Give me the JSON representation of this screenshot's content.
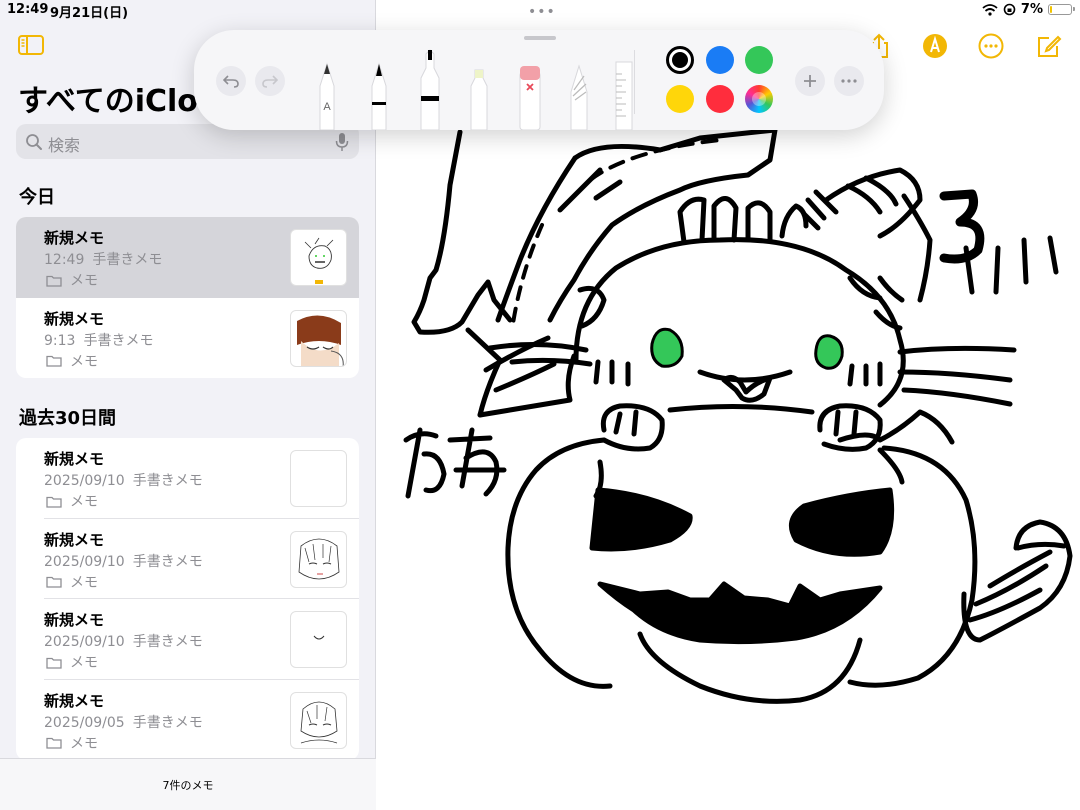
{
  "status": {
    "time": "12:49",
    "date": "9月21日(日)",
    "battery": "7%",
    "battery_level": 0.07
  },
  "sidebar": {
    "title": "すべてのiCloud",
    "search_placeholder": "検索",
    "sections": [
      {
        "title": "今日"
      },
      {
        "title": "過去30日間"
      }
    ],
    "today_notes": [
      {
        "title": "新規メモ",
        "date": "12:49",
        "desc": "手書きメモ",
        "folder": "メモ",
        "selected": true
      },
      {
        "title": "新規メモ",
        "date": "9:13",
        "desc": "手書きメモ",
        "folder": "メモ",
        "selected": false
      }
    ],
    "past_notes": [
      {
        "title": "新規メモ",
        "date": "2025/09/10",
        "desc": "手書きメモ",
        "folder": "メモ"
      },
      {
        "title": "新規メモ",
        "date": "2025/09/10",
        "desc": "手書きメモ",
        "folder": "メモ"
      },
      {
        "title": "新規メモ",
        "date": "2025/09/10",
        "desc": "手書きメモ",
        "folder": "メモ"
      },
      {
        "title": "新規メモ",
        "date": "2025/09/05",
        "desc": "手書きメモ",
        "folder": "メモ"
      }
    ],
    "footer": "7件のメモ"
  },
  "toolbar": {
    "icons": [
      "sidebar-icon",
      "share-icon",
      "markup-icon",
      "more-icon",
      "compose-icon"
    ],
    "accent": "#f2b705"
  },
  "palette": {
    "tools": [
      "monoline-pen",
      "pen",
      "marker",
      "highlighter",
      "eraser",
      "pencil",
      "ruler"
    ],
    "colors": [
      "#000000",
      "#1a7cf5",
      "#34c759",
      "#ffd60a",
      "#ff2d3d",
      "rainbow"
    ],
    "selected_color": "#000000"
  },
  "drawing": {
    "text_kawa": "かわ",
    "text_3": "3"
  }
}
